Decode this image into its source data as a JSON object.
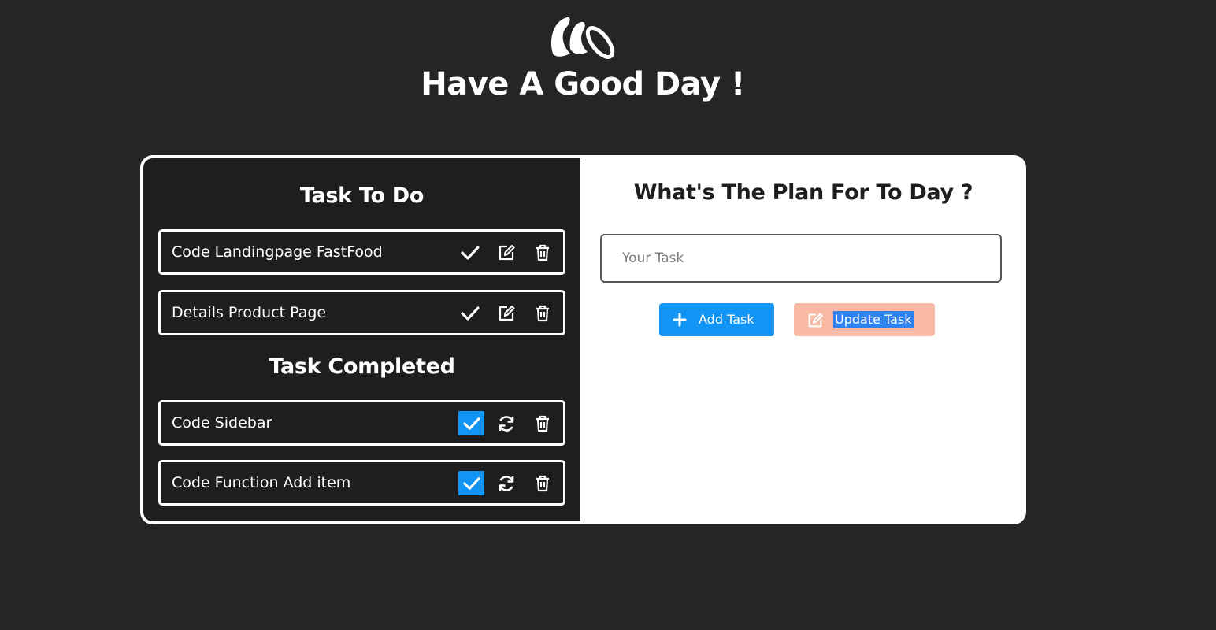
{
  "header": {
    "logo_icon": "brand-logo-icon",
    "title": "Have A Good Day !"
  },
  "todo": {
    "title": "Task To Do",
    "tasks": [
      {
        "label": "Code Landingpage FastFood",
        "icons": [
          "check-icon",
          "edit-icon",
          "trash-icon"
        ]
      },
      {
        "label": "Details Product Page",
        "icons": [
          "check-icon",
          "edit-icon",
          "trash-icon"
        ]
      }
    ]
  },
  "completed": {
    "title": "Task Completed",
    "tasks": [
      {
        "label": "Code Sidebar",
        "icons": [
          "checked-checkbox-icon",
          "refresh-icon",
          "trash-icon"
        ]
      },
      {
        "label": "Code Function Add item",
        "icons": [
          "checked-checkbox-icon",
          "refresh-icon",
          "trash-icon"
        ]
      }
    ]
  },
  "form": {
    "title": "What's The Plan For To Day ?",
    "input_placeholder": "Your Task",
    "input_value": "",
    "add_label": "Add Task",
    "update_label": "Update Task"
  },
  "colors": {
    "background": "#252525",
    "panel_dark": "#1e1e1e",
    "accent_blue": "#1194f4",
    "update_button": "#f8baa4",
    "text_light": "#ffffff"
  }
}
